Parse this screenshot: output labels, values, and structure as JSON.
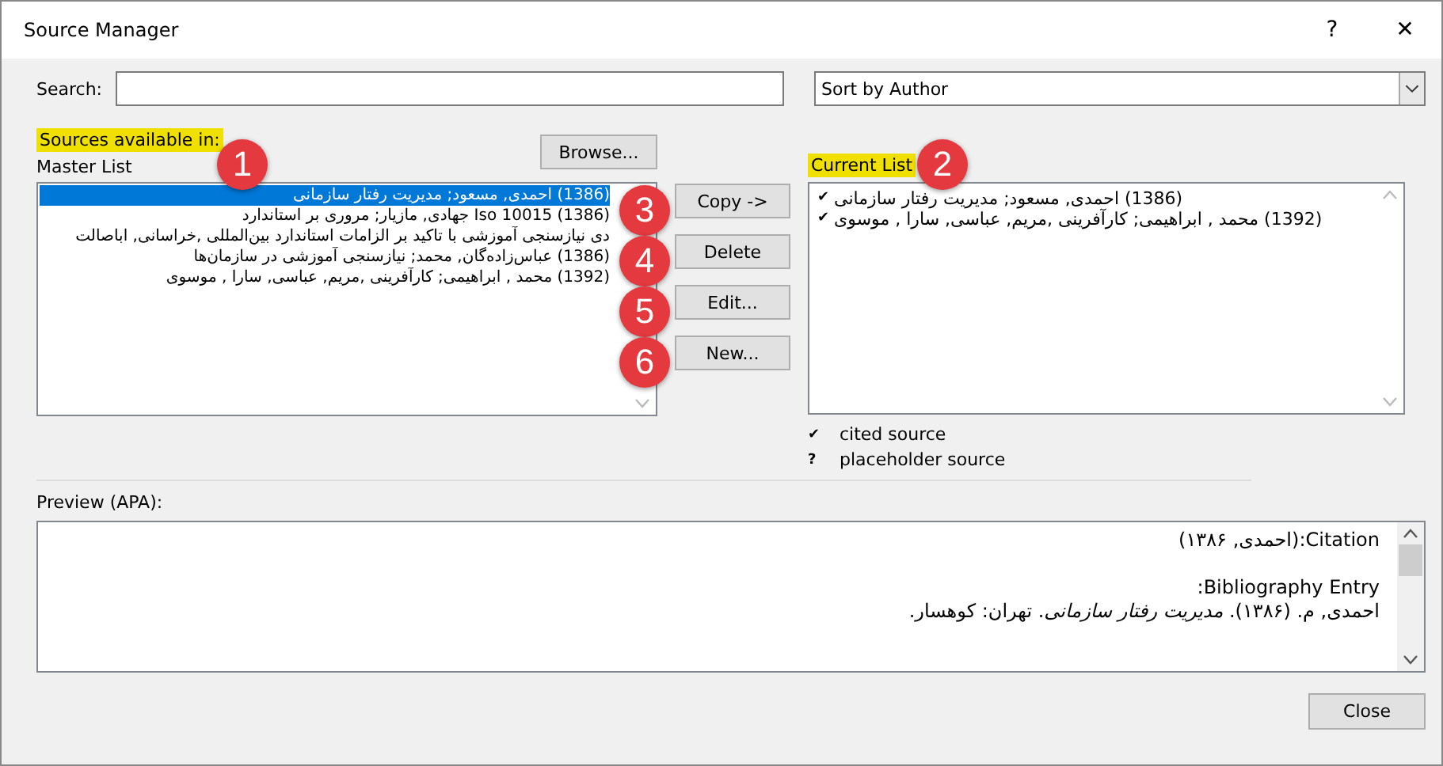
{
  "window": {
    "title": "Source Manager",
    "help": "?",
    "close": "✕"
  },
  "search": {
    "label": "Search:"
  },
  "sort": {
    "value": "Sort by Author"
  },
  "master": {
    "heading": "Sources available in:",
    "label": "Master List",
    "browse": "Browse...",
    "items": [
      {
        "text": "(1386) احمدی, مسعود; مدیریت رفتار سازمانی",
        "selected": true
      },
      {
        "text": "Iso 10015 (1386) جهادی, مازیار; مروری بر استاندارد",
        "selected": false
      },
      {
        "text": "دی نیازسنجی آموزشی با تاکید بر الزامات استاندارد بین‌المللی ,خراسانی, اباصالت",
        "selected": false
      },
      {
        "text": "(1386) عباس‌زاده‌گان, محمد; نیازسنجی آموزشی در سازمان‌ها",
        "selected": false
      },
      {
        "text": "(1392) محمد , ابراهیمی; کارآفرینی ,مریم, عباسی, سارا , موسوی",
        "selected": false
      }
    ]
  },
  "actions": [
    "Copy ->",
    "Delete",
    "Edit...",
    "New..."
  ],
  "current": {
    "heading": "Current List",
    "items": [
      {
        "text": "(1386) احمدی, مسعود; مدیریت رفتار سازمانی",
        "mark": "✔"
      },
      {
        "text": "(1392) محمد , ابراهیمی; کارآفرینی ,مریم, عباسی, سارا , موسوی",
        "mark": "✔"
      }
    ]
  },
  "legend": [
    {
      "symbol": "✔",
      "text": "cited source"
    },
    {
      "symbol": "?",
      "text": "placeholder source"
    }
  ],
  "preview": {
    "label": "Preview (APA):",
    "lines": [
      {
        "kind": "plain",
        "text": "Citation:(احمدی, ۱۳۸۶)"
      },
      {
        "kind": "gap"
      },
      {
        "kind": "plain",
        "text": "Bibliography Entry:"
      },
      {
        "kind": "rich",
        "text": "احمدی, م. (۱۳۸۶). *مدیریت رفتار سازمانی*. تهران: کوهسار."
      }
    ]
  },
  "close_button": "Close",
  "badges": [
    "1",
    "2",
    "3",
    "4",
    "5",
    "6"
  ]
}
